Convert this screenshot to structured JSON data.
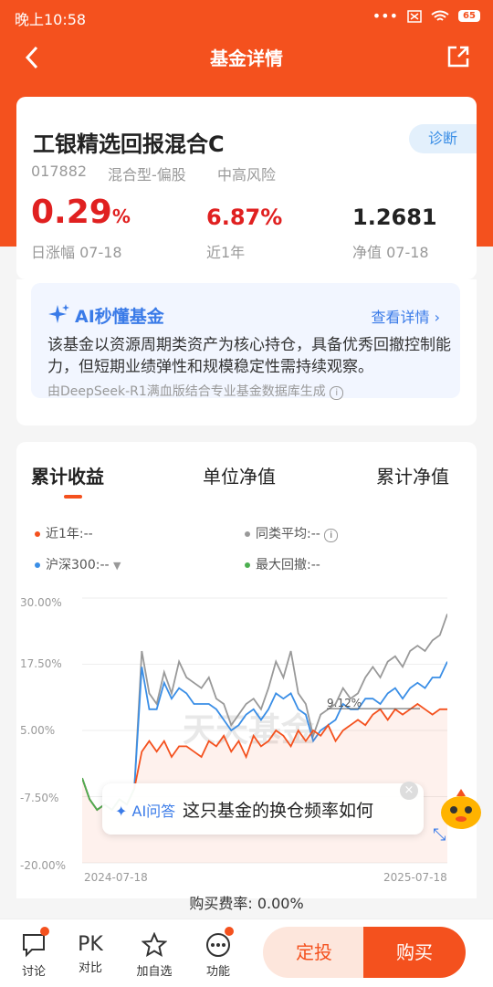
{
  "status": {
    "time": "晚上10:58",
    "battery": "65"
  },
  "nav": {
    "title": "基金详情"
  },
  "fund": {
    "name": "工银精选回报混合C",
    "diagnose": "诊断",
    "code": "017882",
    "type": "混合型-偏股",
    "risk": "中高风险",
    "day_change": "0.29",
    "day_change_unit": "%",
    "day_change_label": "日涨幅 07-18",
    "year_return": "6.87%",
    "year_return_label": "近1年",
    "nav_value": "1.2681",
    "nav_label": "净值 07-18"
  },
  "ai": {
    "title": "AI秒懂基金",
    "more": "查看详情",
    "body": "该基金以资源周期类资产为核心持仓，具备优秀回撤控制能力，但短期业绩弹性和规模稳定性需持续观察。",
    "footer": "由DeepSeek-R1满血版结合专业基金数据库生成"
  },
  "tabs": [
    "累计收益",
    "单位净值",
    "累计净值"
  ],
  "legend": {
    "fund": "近1年:--",
    "peer": "同类平均:--",
    "index": "沪深300:--",
    "drawdown": "最大回撤:--"
  },
  "colors": {
    "accent": "#f4511e",
    "fund": "#f4511e",
    "peer": "#999999",
    "index": "#3a8ee6",
    "drawdown": "#4caf50"
  },
  "chart_data": {
    "type": "line",
    "ylim": [
      -20,
      30
    ],
    "yticks": [
      "30.00%",
      "17.50%",
      "5.00%",
      "-7.50%",
      "-20.00%"
    ],
    "xticks": [
      "2024-07-18",
      "2025-07-18"
    ],
    "annotation": "9.12%",
    "watermark": "天天基金",
    "series": [
      {
        "name": "近1年",
        "values": [
          -4,
          -8,
          -10,
          -9,
          -10,
          -8,
          -9,
          -6,
          1,
          3,
          1,
          3,
          0,
          2,
          2,
          1,
          0,
          3,
          2,
          4,
          1,
          3,
          0,
          4,
          2,
          3,
          5,
          4,
          2,
          5,
          3,
          5,
          4,
          6,
          3,
          5,
          6,
          7,
          6,
          8,
          9,
          7,
          9,
          8,
          9,
          10,
          9,
          8,
          9,
          9
        ]
      },
      {
        "name": "同类平均",
        "values": [
          -4,
          -8,
          -10,
          -9,
          -10,
          -8,
          -9,
          -6,
          20,
          12,
          10,
          16,
          12,
          18,
          15,
          14,
          13,
          15,
          11,
          10,
          6,
          8,
          10,
          11,
          9,
          13,
          18,
          15,
          20,
          12,
          10,
          4,
          8,
          9,
          10,
          13,
          11,
          12,
          15,
          17,
          15,
          18,
          19,
          17,
          20,
          21,
          20,
          22,
          23,
          27
        ]
      },
      {
        "name": "沪深300",
        "values": [
          -4,
          -8,
          -10,
          -9,
          -10,
          -8,
          -9,
          -6,
          17,
          9,
          9,
          14,
          11,
          13,
          12,
          10,
          10,
          10,
          9,
          7,
          5,
          6,
          8,
          9,
          7,
          9,
          12,
          11,
          12,
          9,
          8,
          3,
          5,
          6,
          7,
          10,
          9,
          9,
          11,
          11,
          10,
          12,
          13,
          11,
          13,
          14,
          13,
          15,
          15,
          18
        ]
      }
    ]
  },
  "popup": {
    "label": "AI问答",
    "text": "这只基金的换仓频率如何"
  },
  "fee": "购买费率: 0.00%",
  "bottom": {
    "discuss": "讨论",
    "compare_icon": "PK",
    "compare": "对比",
    "watch": "加自选",
    "func": "功能",
    "auto_invest": "定投",
    "buy": "购买"
  }
}
